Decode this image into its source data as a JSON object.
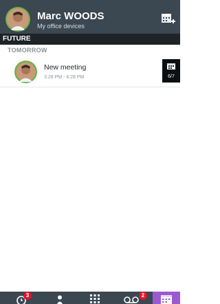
{
  "header": {
    "title": "Marc WOODS",
    "subtitle": "My office devices",
    "add_calendar_icon": "calendar-add-icon"
  },
  "section": {
    "label": "FUTURE"
  },
  "day": {
    "label": "TOMORROW"
  },
  "meetings": [
    {
      "title": "New meeting",
      "time": "3:28 PM - 4:28 PM",
      "date": "6/7"
    }
  ],
  "tabs": [
    {
      "icon": "history-icon",
      "badge": "3"
    },
    {
      "icon": "person-icon",
      "badge": ""
    },
    {
      "icon": "dialpad-icon",
      "badge": ""
    },
    {
      "icon": "voicemail-icon",
      "badge": "2"
    },
    {
      "icon": "calendar-icon",
      "badge": "",
      "active": true
    }
  ],
  "colors": {
    "header_bg": "#3b4751",
    "section_bg": "#1d2327",
    "avatar_ring": "#6ab344",
    "badge_red": "#e0142d",
    "active_tab": "#9b59d0"
  }
}
